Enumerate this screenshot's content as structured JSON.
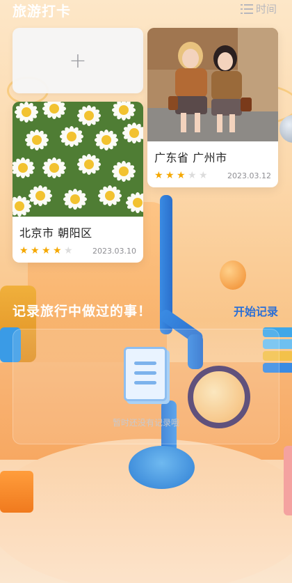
{
  "header": {
    "title": "旅游打卡",
    "sort_label": "时间",
    "sort_icon": "list-icon"
  },
  "add_card": {
    "icon": "plus-icon",
    "label": "+"
  },
  "cards": [
    {
      "location": "北京市 朝阳区",
      "rating": 4,
      "max_rating": 5,
      "date": "2023.03.10",
      "photo": "daisy-flowers"
    },
    {
      "location": "广东省 广州市",
      "rating": 3,
      "max_rating": 5,
      "date": "2023.03.12",
      "photo": "two-girls-sitting"
    }
  ],
  "section": {
    "title": "记录旅行中做过的事！",
    "action": "开始记录"
  },
  "empty_state": {
    "text": "暂时还没有记录哦"
  },
  "colors": {
    "star_on": "#f5a800",
    "star_off": "#dcdcdc",
    "accent": "#2b6fd6"
  }
}
